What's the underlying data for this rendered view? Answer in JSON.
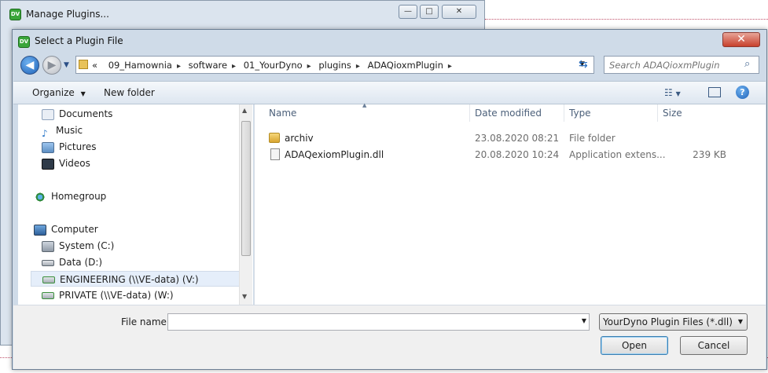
{
  "background_window": {
    "title": "Manage Plugins...",
    "icon": "app-icon",
    "buttons": [
      "—",
      "□",
      "✕"
    ]
  },
  "dialog": {
    "title": "Select a Plugin File",
    "close_label": "✕",
    "address": {
      "overflow": "«",
      "crumbs": [
        "09_Hamownia",
        "software",
        "01_YourDyno",
        "plugins",
        "ADAQioxmPlugin"
      ]
    },
    "search": {
      "placeholder": "Search ADAQioxmPlugin"
    },
    "toolbar": {
      "organize": "Organize",
      "new_folder": "New folder"
    },
    "nav": {
      "items": [
        {
          "label": "Documents",
          "icon": "documents-icon",
          "indent": 2
        },
        {
          "label": "Music",
          "icon": "music-icon",
          "indent": 2
        },
        {
          "label": "Pictures",
          "icon": "pictures-icon",
          "indent": 2
        },
        {
          "label": "Videos",
          "icon": "videos-icon",
          "indent": 2
        },
        {
          "label": "Homegroup",
          "icon": "homegroup-icon",
          "indent": 1
        },
        {
          "label": "Computer",
          "icon": "computer-icon",
          "indent": 1
        },
        {
          "label": "System (C:)",
          "icon": "drive-icon",
          "indent": 2
        },
        {
          "label": "Data (D:)",
          "icon": "drive-icon",
          "indent": 2
        },
        {
          "label": "ENGINEERING (\\\\VE-data) (V:)",
          "icon": "network-drive-icon",
          "indent": 2,
          "selected": true
        },
        {
          "label": "PRIVATE (\\\\VE-data) (W:)",
          "icon": "network-drive-icon",
          "indent": 2
        }
      ]
    },
    "files": {
      "columns": {
        "name": "Name",
        "date": "Date modified",
        "type": "Type",
        "size": "Size"
      },
      "rows": [
        {
          "name": "archiv",
          "date": "23.08.2020 08:21",
          "type": "File folder",
          "size": "",
          "icon": "folder-icon"
        },
        {
          "name": "ADAQexiomPlugin.dll",
          "date": "20.08.2020 10:24",
          "type": "Application extens...",
          "size": "239 KB",
          "icon": "dll-icon"
        }
      ]
    },
    "bottom": {
      "filename_label": "File name:",
      "filename_value": "",
      "filter": "YourDyno Plugin Files (*.dll)",
      "open": "Open",
      "cancel": "Cancel"
    }
  }
}
